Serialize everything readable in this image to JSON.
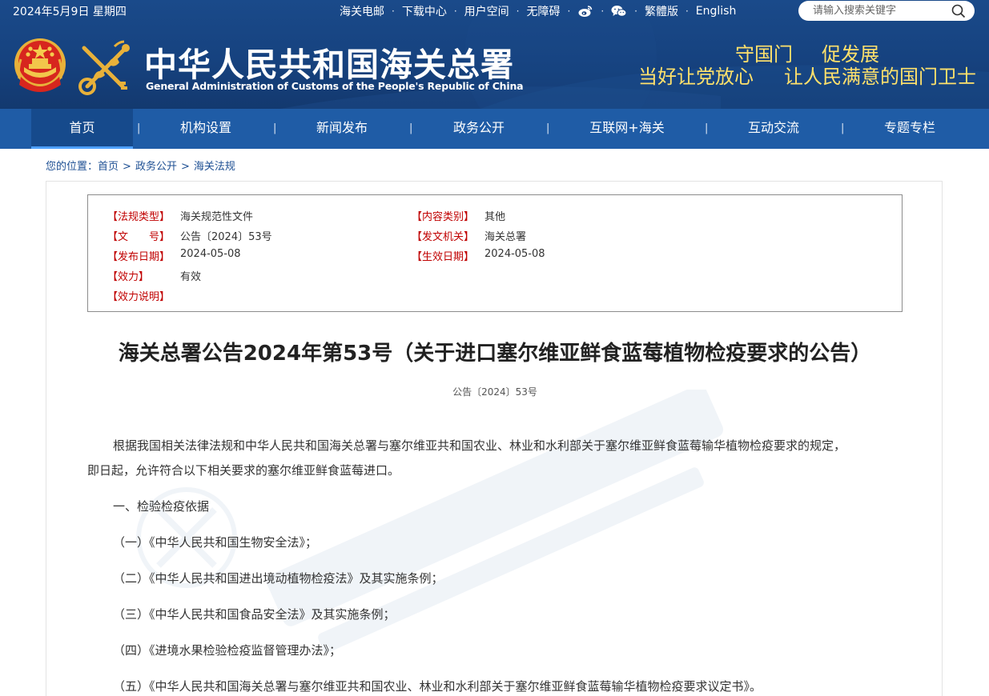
{
  "topbar": {
    "date": "2024年5月9日 星期四",
    "links": [
      "海关电邮",
      "下载中心",
      "用户空间",
      "无障碍"
    ],
    "weibo_icon": "weibo-icon",
    "wechat_icon": "wechat-icon",
    "traditional": "繁體版",
    "english": "English",
    "separator": "·"
  },
  "search": {
    "placeholder": "请输入搜索关键字",
    "icon": "search-icon"
  },
  "header": {
    "title": "中华人民共和国海关总署",
    "subtitle": "General Administration of Customs of the People's Republic of China",
    "slogan_line1": [
      "守国门",
      "促发展"
    ],
    "slogan_line2": [
      "当好让党放心",
      "让人民满意的国门卫士"
    ]
  },
  "nav": {
    "items": [
      "首页",
      "机构设置",
      "新闻发布",
      "政务公开",
      "互联网+海关",
      "互动交流",
      "专题专栏"
    ],
    "active_index": 0,
    "separator": "|"
  },
  "breadcrumb": {
    "prefix": "您的位置：",
    "items": [
      "首页",
      "政务公开",
      "海关法规"
    ],
    "separator": ">"
  },
  "meta": {
    "rows": [
      {
        "label": "【法规类型】",
        "value": "海关规范性文件"
      },
      {
        "label": "【内容类别】",
        "value": "其他"
      },
      {
        "label": "【文　　号】",
        "value": "公告〔2024〕53号"
      },
      {
        "label": "【发文机关】",
        "value": "海关总署"
      },
      {
        "label": "【发布日期】",
        "value": "2024-05-08"
      },
      {
        "label": "【生效日期】",
        "value": "2024-05-08"
      },
      {
        "label": "【效力】",
        "value": "有效"
      },
      {
        "label": "【效力说明】",
        "value": ""
      }
    ]
  },
  "document": {
    "title": "海关总署公告2024年第53号（关于进口塞尔维亚鲜食蓝莓植物检疫要求的公告）",
    "number": "公告〔2024〕53号",
    "intro_line1": "根据我国相关法律法规和中华人民共和国海关总署与塞尔维亚共和国农业、林业和水利部关于塞尔维亚鲜食蓝莓输华植物检疫要求的规定，",
    "intro_line2": "即日起，允许符合以下相关要求的塞尔维亚鲜食蓝莓进口。",
    "section1": "一、检验检疫依据",
    "items": [
      "（一）《中华人民共和国生物安全法》；",
      "（二）《中华人民共和国进出境动植物检疫法》及其实施条例；",
      "（三）《中华人民共和国食品安全法》及其实施条例；",
      "（四）《进境水果检验检疫监督管理办法》；",
      "（五）《中华人民共和国海关总署与塞尔维亚共和国农业、林业和水利部关于塞尔维亚鲜食蓝莓输华植物检疫要求议定书》。"
    ]
  },
  "colors": {
    "header_blue": "#16427f",
    "nav_blue": "#1f5ca6",
    "slogan_yellow": "#ffe16b",
    "label_red": "#c00000",
    "link_blue": "#1d4f93"
  }
}
